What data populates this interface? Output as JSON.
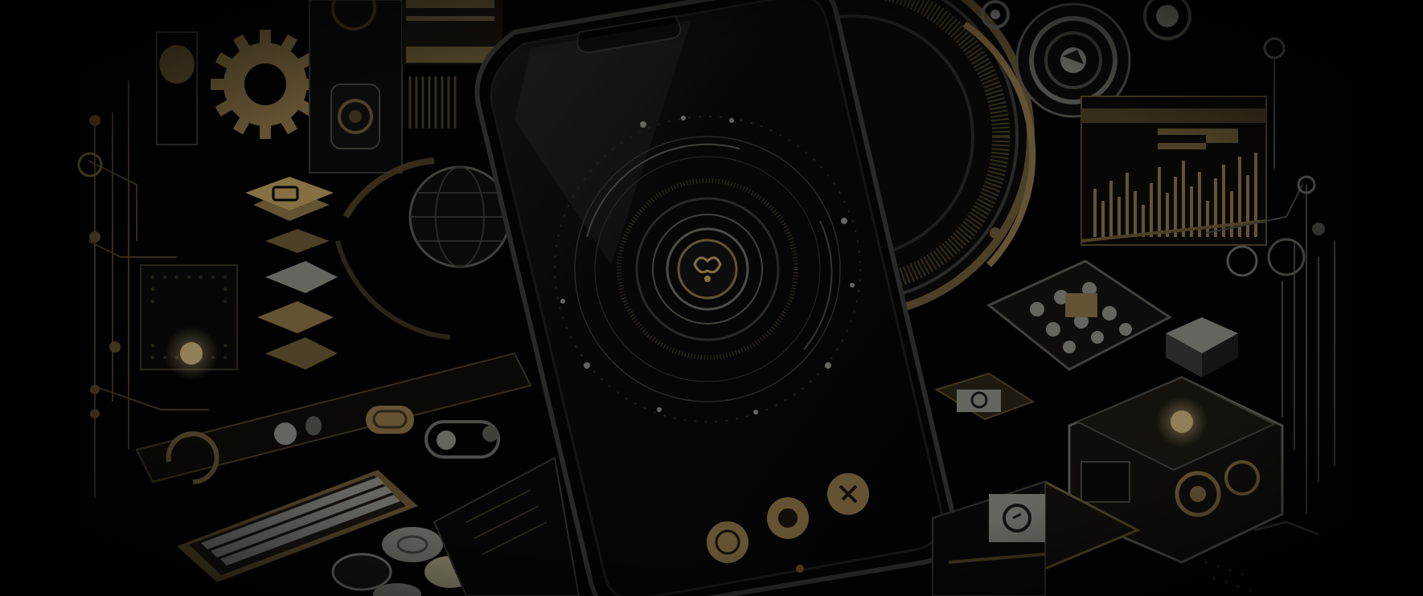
{
  "scene": {
    "description_hidden": "",
    "palette": {
      "background": "#020202",
      "gold": "#8a7446",
      "gold_bright": "#b89c5e",
      "gold_dim": "#4a3e25",
      "silver": "#8c8c86",
      "phone_body": "#050505",
      "phone_edge": "#3a3a36"
    },
    "icons": [
      "gear-icon",
      "camera-lens-icon",
      "keyboard-icon",
      "equalizer-icon",
      "circular-dial-icon",
      "chip-icon",
      "action-camera-icon"
    ]
  }
}
